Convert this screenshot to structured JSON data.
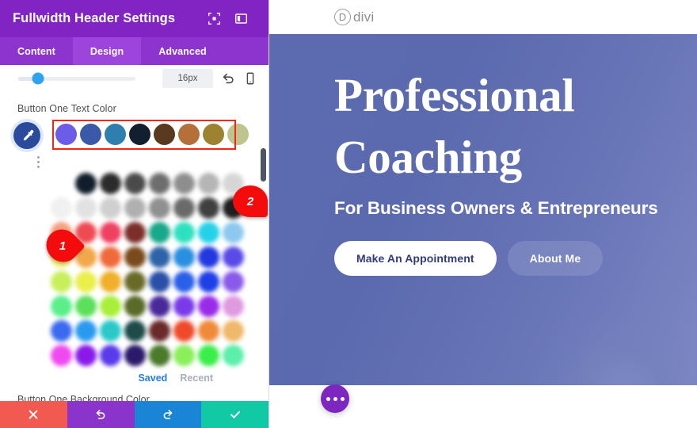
{
  "panel": {
    "title": "Fullwidth Header Settings",
    "header_icons": [
      {
        "name": "expand-icon"
      },
      {
        "name": "layout-split-icon"
      }
    ],
    "tabs": [
      {
        "label": "Content",
        "active": false
      },
      {
        "label": "Design",
        "active": true
      },
      {
        "label": "Advanced",
        "active": false
      }
    ],
    "slider": {
      "value": "16px",
      "reset_icon": "undo-icon",
      "responsive_icon": "mobile-icon"
    },
    "text_color_label": "Button One Text Color",
    "background_color_label": "Button One Background Color",
    "eyedropper_icon": "eyedropper-icon",
    "preset_swatches": [
      "#6c5ce7",
      "#3a5aa8",
      "#2e7fae",
      "#111f2e",
      "#5a3a1e",
      "#b5703a",
      "#9d8232",
      "#bfc48f"
    ],
    "palette_rows": [
      [
        "#ffffff",
        "#111d2b",
        "#2b2b2b",
        "#4a4a4a",
        "#6e6e6e",
        "#8e8e8e",
        "#b5b5b5",
        "#d6d6d6"
      ],
      [
        "#f0f0f0",
        "#e2e2e2",
        "#cfcfcf",
        "#b0b0b0",
        "#909090",
        "#6a6a6a",
        "#3f3f3f",
        "#1f1f1f"
      ],
      [
        "#f3a07e",
        "#ef4a52",
        "#ef4060",
        "#7c2f2a",
        "#18a88a",
        "#2fe0c0",
        "#24d2e8",
        "#8cc8ef"
      ],
      [
        "#f6ef7a",
        "#f0a84a",
        "#ef6a3a",
        "#7a4a1c",
        "#2d63a8",
        "#2a8fe0",
        "#2138e0",
        "#5a4ae8"
      ],
      [
        "#c8ef5a",
        "#eaef4a",
        "#f0b029",
        "#6a6a28",
        "#2a4fa8",
        "#2a5fe8",
        "#1f3fe8",
        "#8a5aea"
      ],
      [
        "#5aef8a",
        "#5ae05a",
        "#a8ef3a",
        "#5a6a28",
        "#4a2a9a",
        "#7a3aea",
        "#9a2aea",
        "#e09ae0"
      ],
      [
        "#3a6aef",
        "#2a9aef",
        "#2ac8c8",
        "#1e4a4a",
        "#6a2a2a",
        "#ef4a2a",
        "#ef8a3a",
        "#efb86a"
      ],
      [
        "#ef4aef",
        "#8a1aea",
        "#5a3aea",
        "#2a1a6a",
        "#4a7a2a",
        "#8aef5a",
        "#3aef4a",
        "#5aefaa"
      ]
    ],
    "saved_link": "Saved",
    "recent_link": "Recent",
    "actions": [
      {
        "name": "cancel-button",
        "icon": "close-icon",
        "color": "#f25a51"
      },
      {
        "name": "undo-button",
        "icon": "undo-icon",
        "color": "#8b34cc"
      },
      {
        "name": "redo-button",
        "icon": "redo-icon",
        "color": "#1a84d6"
      },
      {
        "name": "save-button",
        "icon": "check-icon",
        "color": "#11c9a4"
      }
    ]
  },
  "annotations": [
    {
      "label": "2",
      "name": "annotation-badge-2"
    },
    {
      "label": "1",
      "name": "annotation-badge-1"
    }
  ],
  "preview": {
    "logo_letter": "D",
    "logo_text": "divi",
    "heading_line1": "Professional",
    "heading_line2": "Coaching",
    "subheading": "For Business Owners & Entrepreneurs",
    "primary_button": "Make An Appointment",
    "secondary_button": "About Me",
    "fab_icon": "more-dots-icon"
  }
}
